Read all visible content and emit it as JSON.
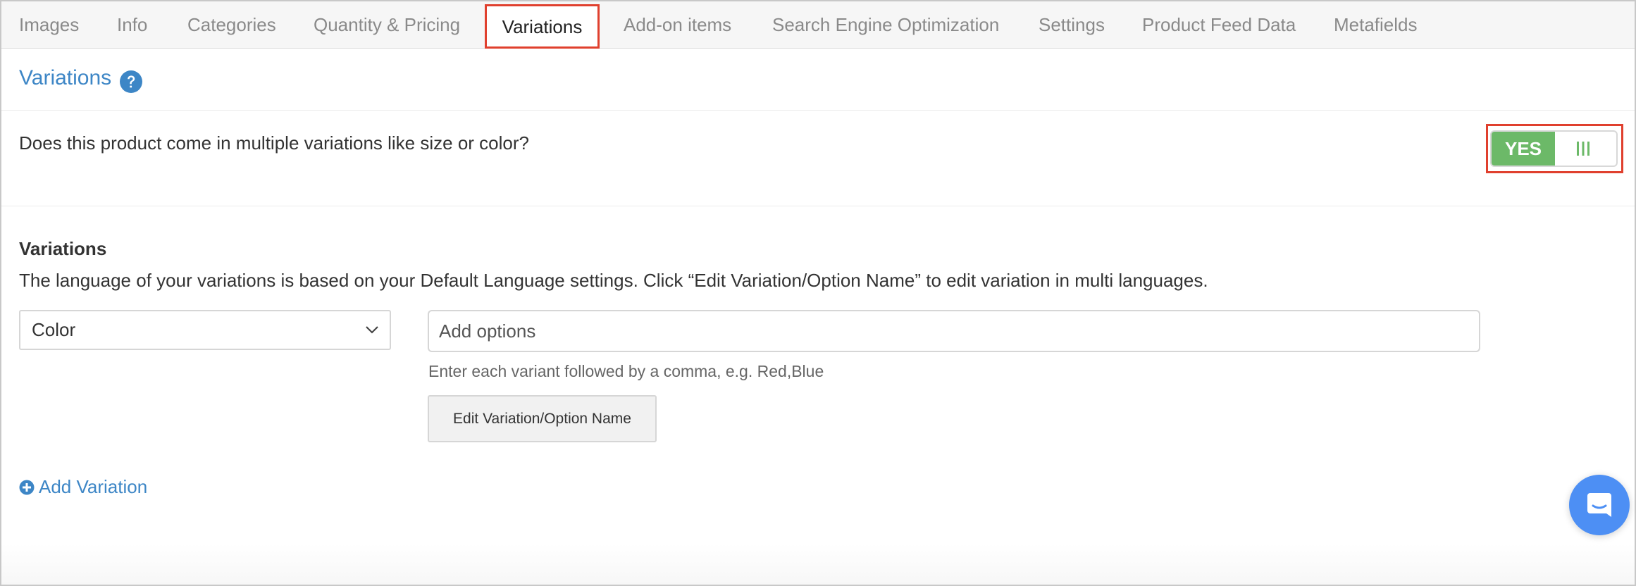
{
  "tabs": [
    {
      "label": "Images",
      "active": false
    },
    {
      "label": "Info",
      "active": false
    },
    {
      "label": "Categories",
      "active": false
    },
    {
      "label": "Quantity & Pricing",
      "active": false
    },
    {
      "label": "Variations",
      "active": true
    },
    {
      "label": "Add-on items",
      "active": false
    },
    {
      "label": "Search Engine Optimization",
      "active": false
    },
    {
      "label": "Settings",
      "active": false
    },
    {
      "label": "Product Feed Data",
      "active": false
    },
    {
      "label": "Metafields",
      "active": false
    }
  ],
  "section": {
    "title": "Variations",
    "help_icon": "question-circle-icon"
  },
  "question": {
    "text": "Does this product come in multiple variations like size or color?",
    "toggle_label": "YES",
    "toggle_on": true,
    "toggle_color": "#6cb968"
  },
  "variations": {
    "heading": "Variations",
    "description": "The language of your variations is based on your Default Language settings. Click “Edit Variation/Option Name” to edit variation in multi languages.",
    "select_value": "Color",
    "options_placeholder": "Add options",
    "hint": "Enter each variant followed by a comma, e.g. Red,Blue",
    "edit_button_label": "Edit Variation/Option Name",
    "add_variation_label": "Add Variation"
  },
  "colors": {
    "accent_blue": "#3d86c6",
    "highlight_red": "#e0402e",
    "chat_blue": "#4d8ff4"
  },
  "chat": {
    "icon": "chat-bubble-icon"
  }
}
